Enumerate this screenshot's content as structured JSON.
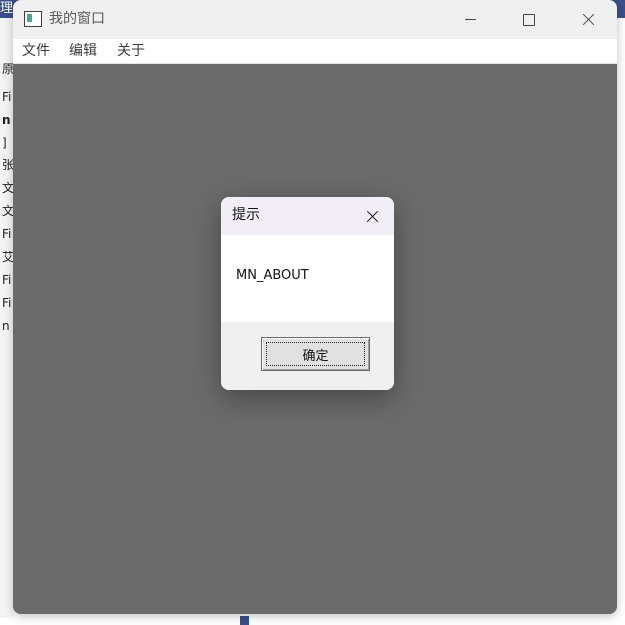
{
  "background_window": {
    "title_fragment": "理",
    "lines": [
      "原",
      "Fi",
      "n",
      "]",
      "张",
      "文",
      "文",
      "Fi",
      "艾",
      "Fi",
      "Fi",
      "n"
    ]
  },
  "window": {
    "title": "我的窗口",
    "icon": "app-window-icon",
    "controls": {
      "minimize": "minimize-icon",
      "maximize": "maximize-icon",
      "close": "close-icon"
    }
  },
  "menu": {
    "items": [
      "文件",
      "编辑",
      "关于"
    ]
  },
  "client_area": {
    "background": "#6b6b6b"
  },
  "dialog": {
    "title": "提示",
    "message": "MN_ABOUT",
    "ok_label": "确定",
    "close_icon": "close-icon"
  },
  "colors": {
    "titlebar": "#f0f0f0",
    "menubar": "#ffffff",
    "client": "#6b6b6b",
    "dialog_title": "#f2eef5",
    "dialog_body": "#ffffff",
    "dialog_footer": "#f0f0f0"
  }
}
